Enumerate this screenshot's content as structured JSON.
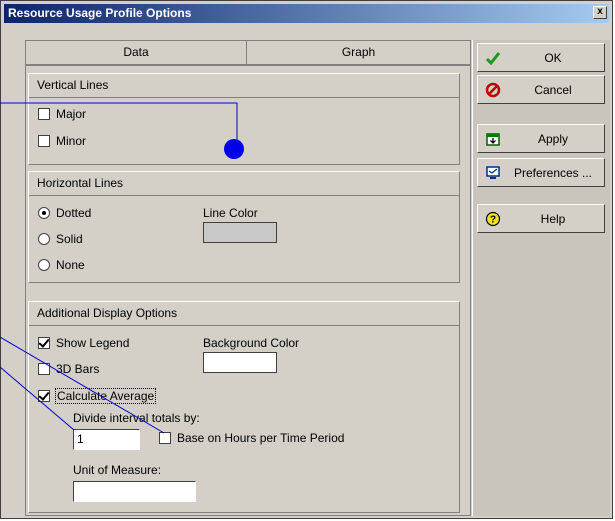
{
  "window": {
    "title": "Resource Usage Profile Options",
    "close_glyph": "x"
  },
  "tabs": [
    {
      "label": "Data"
    },
    {
      "label": "Graph",
      "selected": true
    }
  ],
  "vertical_lines": {
    "heading": "Vertical Lines",
    "major": {
      "label": "Major",
      "checked": false
    },
    "minor": {
      "label": "Minor",
      "checked": false
    }
  },
  "horizontal_lines": {
    "heading": "Horizontal Lines",
    "options": [
      {
        "label": "Dotted",
        "selected": true
      },
      {
        "label": "Solid",
        "selected": false
      },
      {
        "label": "None",
        "selected": false
      }
    ],
    "line_color_label": "Line Color",
    "line_color": "#c8c8c8"
  },
  "additional": {
    "heading": "Additional Display Options",
    "show_legend": {
      "label": "Show Legend",
      "checked": true
    },
    "bars_3d": {
      "label": "3D Bars",
      "checked": false
    },
    "calculate_average": {
      "label": "Calculate Average",
      "checked": true
    },
    "background_color_label": "Background Color",
    "background_color": "#ffffff",
    "divide_label": "Divide interval totals by:",
    "divide_value": "1",
    "base_on_hours": {
      "label": "Base on Hours per Time Period",
      "checked": false
    },
    "unit_label": "Unit of Measure:",
    "unit_value": ""
  },
  "buttons": {
    "ok": "OK",
    "cancel": "Cancel",
    "apply": "Apply",
    "preferences": "Preferences ...",
    "help": "Help"
  },
  "colors": {
    "title_start": "#0a246a",
    "title_end": "#a6caf0",
    "callout": "#0000cc"
  }
}
